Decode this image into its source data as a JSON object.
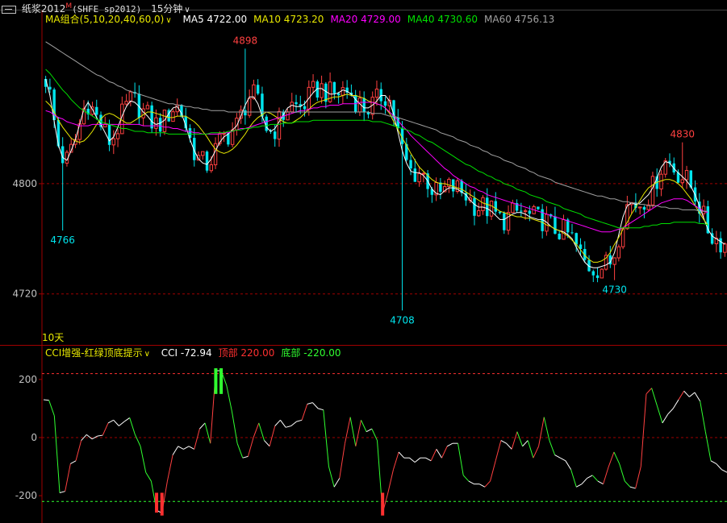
{
  "title_bar": {
    "symbol_name": "纸浆2012",
    "main_flag": "M",
    "code": "(SHFE sp2012)",
    "period": "15分钟",
    "period_arrow": "∨"
  },
  "ma_legend": {
    "name": "MA组合(5,10,20,40,60,0)",
    "arrow": "∨",
    "items": [
      {
        "label": "MA5 4722.00",
        "color": "#ffffff"
      },
      {
        "label": "MA10 4723.20",
        "color": "#e8e800"
      },
      {
        "label": "MA20 4729.00",
        "color": "#ff00ff"
      },
      {
        "label": "MA40 4730.60",
        "color": "#00e000"
      },
      {
        "label": "MA60 4756.13",
        "color": "#a0a0a0"
      }
    ]
  },
  "cci_legend": {
    "name": "CCI增强-红绿顶底提示",
    "arrow": "∨",
    "items": [
      {
        "label": "CCI -72.94",
        "color": "#ffffff"
      },
      {
        "label": "顶部 220.00",
        "color": "#ff3030"
      },
      {
        "label": "底部 -220.00",
        "color": "#30ff30"
      }
    ]
  },
  "range_label": "10天",
  "colors": {
    "up": "#ff4040",
    "down": "#00e5ee",
    "frame": "#a00000",
    "grid": "#a00000",
    "cci_top": "#ff3030",
    "cci_bottom": "#30ff30"
  },
  "chart_data": [
    {
      "type": "candlestick",
      "y_ticks": [
        4800,
        4720
      ],
      "ylim": [
        4683,
        4914
      ],
      "annotations": [
        {
          "text": "4898",
          "value": 4898,
          "index": 47,
          "kind": "high"
        },
        {
          "text": "4830",
          "value": 4830,
          "index": 150,
          "kind": "high"
        },
        {
          "text": "4766",
          "value": 4766,
          "index": 4,
          "kind": "low"
        },
        {
          "text": "4708",
          "value": 4708,
          "index": 84,
          "kind": "low"
        },
        {
          "text": "4730",
          "value": 4730,
          "index": 134,
          "kind": "low"
        }
      ],
      "series": [
        {
          "name": "MA5",
          "color": "#ffffff",
          "values": [
            4876,
            4864,
            4845,
            4828,
            4819,
            4817,
            4824,
            4832,
            4843,
            4854,
            4859,
            4854,
            4848,
            4843,
            4837,
            4831,
            4834,
            4841,
            4849,
            4856,
            4860,
            4859,
            4856,
            4852,
            4849,
            4845,
            4843,
            4844,
            4846,
            4851,
            4855,
            4856,
            4851,
            4842,
            4832,
            4824,
            4818,
            4815,
            4814,
            4818,
            4824,
            4830,
            4834,
            4836,
            4839,
            4842,
            4849,
            4857,
            4863,
            4863,
            4858,
            4849,
            4841,
            4838,
            4840,
            4845,
            4850,
            4855,
            4857,
            4856,
            4856,
            4858,
            4862,
            4866,
            4869,
            4869,
            4867,
            4865,
            4865,
            4866,
            4868,
            4867,
            4865,
            4861,
            4858,
            4855,
            4855,
            4857,
            4860,
            4864,
            4864,
            4860,
            4850,
            4837,
            4824,
            4815,
            4809,
            4808,
            4808,
            4806,
            4802,
            4796,
            4793,
            4792,
            4795,
            4797,
            4797,
            4796,
            4794,
            4792,
            4788,
            4785,
            4783,
            4783,
            4782,
            4780,
            4777,
            4774,
            4774,
            4776,
            4778,
            4779,
            4779,
            4778,
            4776,
            4775,
            4774,
            4774,
            4772,
            4769,
            4767,
            4766,
            4765,
            4763,
            4760,
            4754,
            4748,
            4743,
            4740,
            4739,
            4739,
            4740,
            4741,
            4743,
            4750,
            4763,
            4776,
            4784,
            4786,
            4785,
            4786,
            4789,
            4792,
            4797,
            4804,
            4812,
            4816,
            4815,
            4811,
            4808,
            4805,
            4802,
            4798,
            4792,
            4784,
            4775,
            4767,
            4762,
            4760,
            4758,
            4756
          ]
        },
        {
          "name": "MA10",
          "color": "#e8e800",
          "values": [
            4860,
            4857,
            4852,
            4846,
            4841,
            4837,
            4833,
            4831,
            4830,
            4831,
            4834,
            4838,
            4843,
            4847,
            4850,
            4851,
            4850,
            4848,
            4846,
            4844,
            4844,
            4846,
            4848,
            4850,
            4852,
            4852,
            4851,
            4850,
            4849,
            4848,
            4848,
            4849,
            4849,
            4849,
            4847,
            4845,
            4842,
            4838,
            4834,
            4829,
            4825,
            4823,
            4822,
            4823,
            4825,
            4828,
            4832,
            4836,
            4841,
            4845,
            4848,
            4850,
            4852,
            4851,
            4849,
            4847,
            4845,
            4844,
            4844,
            4846,
            4848,
            4851,
            4854,
            4857,
            4859,
            4860,
            4861,
            4862,
            4863,
            4863,
            4864,
            4865,
            4864,
            4864,
            4863,
            4862,
            4860,
            4859,
            4858,
            4857,
            4855,
            4851,
            4845,
            4839,
            4833,
            4828,
            4822,
            4817,
            4812,
            4809,
            4806,
            4803,
            4801,
            4800,
            4800,
            4799,
            4798,
            4797,
            4796,
            4794,
            4792,
            4790,
            4788,
            4786,
            4785,
            4784,
            4782,
            4780,
            4779,
            4778,
            4777,
            4776,
            4776,
            4775,
            4775,
            4774,
            4773,
            4772,
            4770,
            4769,
            4767,
            4766,
            4764,
            4762,
            4759,
            4756,
            4752,
            4748,
            4745,
            4743,
            4743,
            4744,
            4746,
            4750,
            4756,
            4761,
            4767,
            4772,
            4778,
            4783,
            4788,
            4793,
            4797,
            4799,
            4801,
            4802,
            4803,
            4803,
            4802,
            4800,
            4797,
            4793,
            4789,
            4784,
            4779,
            4774,
            4770
          ]
        },
        {
          "name": "MA20",
          "color": "#ff00ff",
          "values": [
            4853,
            4852,
            4850,
            4848,
            4847,
            4845,
            4844,
            4843,
            4842,
            4842,
            4842,
            4843,
            4843,
            4843,
            4843,
            4843,
            4843,
            4843,
            4843,
            4843,
            4843,
            4843,
            4843,
            4842,
            4842,
            4842,
            4842,
            4842,
            4841,
            4841,
            4840,
            4840,
            4839,
            4838,
            4838,
            4837,
            4837,
            4836,
            4836,
            4836,
            4836,
            4836,
            4837,
            4837,
            4838,
            4839,
            4840,
            4840,
            4841,
            4842,
            4843,
            4844,
            4845,
            4846,
            4847,
            4848,
            4849,
            4850,
            4851,
            4852,
            4853,
            4853,
            4854,
            4855,
            4855,
            4856,
            4856,
            4857,
            4857,
            4857,
            4858,
            4858,
            4858,
            4858,
            4859,
            4859,
            4859,
            4859,
            4858,
            4857,
            4855,
            4852,
            4849,
            4846,
            4842,
            4839,
            4835,
            4832,
            4829,
            4826,
            4823,
            4820,
            4817,
            4814,
            4811,
            4809,
            4806,
            4804,
            4802,
            4800,
            4798,
            4797,
            4795,
            4794,
            4792,
            4791,
            4790,
            4789,
            4788,
            4787,
            4786,
            4785,
            4784,
            4783,
            4782,
            4781,
            4780,
            4779,
            4778,
            4777,
            4776,
            4775,
            4774,
            4773,
            4772,
            4771,
            4770,
            4769,
            4768,
            4767,
            4766,
            4765,
            4765,
            4765,
            4766,
            4767,
            4768,
            4770,
            4772,
            4774,
            4776,
            4778,
            4780,
            4782,
            4784,
            4786,
            4787,
            4788,
            4789,
            4789,
            4789,
            4788,
            4786,
            4784,
            4782,
            4780,
            4779
          ]
        },
        {
          "name": "MA40",
          "color": "#00e000",
          "values": [
            4883,
            4880,
            4876,
            4872,
            4868,
            4865,
            4861,
            4858,
            4855,
            4853,
            4851,
            4849,
            4847,
            4845,
            4844,
            4843,
            4842,
            4841,
            4840,
            4840,
            4839,
            4838,
            4838,
            4838,
            4837,
            4837,
            4837,
            4837,
            4837,
            4836,
            4836,
            4836,
            4836,
            4836,
            4836,
            4836,
            4836,
            4836,
            4836,
            4837,
            4837,
            4837,
            4837,
            4838,
            4838,
            4839,
            4839,
            4840,
            4840,
            4841,
            4841,
            4842,
            4842,
            4843,
            4843,
            4843,
            4844,
            4844,
            4844,
            4845,
            4845,
            4845,
            4845,
            4846,
            4846,
            4846,
            4846,
            4846,
            4846,
            4846,
            4846,
            4846,
            4846,
            4846,
            4846,
            4846,
            4846,
            4845,
            4845,
            4845,
            4844,
            4843,
            4842,
            4841,
            4840,
            4839,
            4838,
            4836,
            4835,
            4833,
            4831,
            4830,
            4828,
            4826,
            4824,
            4822,
            4820,
            4818,
            4816,
            4814,
            4813,
            4811,
            4809,
            4808,
            4806,
            4805,
            4803,
            4802,
            4800,
            4799,
            4798,
            4796,
            4795,
            4794,
            4792,
            4791,
            4790,
            4789,
            4787,
            4786,
            4785,
            4784,
            4782,
            4781,
            4780,
            4779,
            4778,
            4776,
            4775,
            4774,
            4773,
            4772,
            4771,
            4770,
            4769,
            4768,
            4768,
            4768,
            4768,
            4768,
            4768,
            4769,
            4769,
            4770,
            4770,
            4771,
            4771,
            4771,
            4772,
            4772,
            4772,
            4772,
            4772,
            4772,
            4771,
            4771,
            4770
          ]
        },
        {
          "name": "MA60",
          "color": "#a0a0a0",
          "values": [
            4903,
            4901,
            4899,
            4897,
            4895,
            4893,
            4891,
            4889,
            4887,
            4885,
            4883,
            4881,
            4879,
            4878,
            4876,
            4874,
            4873,
            4871,
            4870,
            4868,
            4867,
            4866,
            4865,
            4864,
            4863,
            4862,
            4861,
            4860,
            4859,
            4858,
            4858,
            4857,
            4857,
            4856,
            4856,
            4855,
            4855,
            4854,
            4854,
            4853,
            4853,
            4853,
            4853,
            4852,
            4852,
            4852,
            4852,
            4852,
            4852,
            4852,
            4852,
            4852,
            4852,
            4852,
            4852,
            4852,
            4852,
            4852,
            4852,
            4852,
            4852,
            4852,
            4852,
            4852,
            4852,
            4852,
            4852,
            4852,
            4852,
            4852,
            4852,
            4852,
            4852,
            4852,
            4852,
            4852,
            4852,
            4851,
            4851,
            4851,
            4850,
            4849,
            4849,
            4848,
            4847,
            4846,
            4845,
            4844,
            4843,
            4842,
            4841,
            4840,
            4839,
            4837,
            4836,
            4835,
            4834,
            4832,
            4831,
            4830,
            4828,
            4827,
            4826,
            4824,
            4823,
            4821,
            4820,
            4819,
            4817,
            4816,
            4815,
            4813,
            4812,
            4811,
            4809,
            4808,
            4806,
            4805,
            4804,
            4803,
            4801,
            4800,
            4799,
            4798,
            4797,
            4796,
            4795,
            4794,
            4793,
            4792,
            4791,
            4791,
            4790,
            4789,
            4789,
            4788,
            4787,
            4787,
            4786,
            4786,
            4785,
            4785,
            4784,
            4784,
            4784,
            4783,
            4783,
            4782,
            4782,
            4782,
            4781,
            4781,
            4781,
            4781,
            4780,
            4780,
            4780
          ]
        }
      ]
    },
    {
      "type": "line",
      "name": "CCI",
      "y_ticks": [
        200,
        0,
        -200
      ],
      "ylim": [
        -294,
        266
      ],
      "top_line": 220,
      "bottom_line": -220,
      "series": [
        {
          "name": "CCI",
          "values": [
            130,
            128,
            75,
            -190,
            -185,
            -90,
            -80,
            -10,
            10,
            -5,
            5,
            8,
            50,
            60,
            40,
            55,
            68,
            10,
            -30,
            -120,
            -150,
            -250,
            -260,
            -150,
            -60,
            -30,
            -40,
            -30,
            -40,
            30,
            50,
            -20,
            230,
            230,
            180,
            90,
            -20,
            -70,
            -65,
            0,
            50,
            -10,
            -30,
            40,
            60,
            35,
            40,
            55,
            60,
            115,
            120,
            100,
            95,
            -100,
            -170,
            -140,
            -20,
            70,
            -30,
            60,
            20,
            30,
            -10,
            -260,
            -190,
            -110,
            -50,
            -70,
            -70,
            -85,
            -70,
            -70,
            -80,
            -40,
            -70,
            -30,
            -20,
            -20,
            -130,
            -150,
            -160,
            -160,
            -170,
            -150,
            -80,
            -10,
            -20,
            -40,
            20,
            -30,
            -10,
            -70,
            -30,
            70,
            -10,
            -60,
            -70,
            -80,
            -110,
            -170,
            -160,
            -140,
            -130,
            -150,
            -160,
            -100,
            -50,
            -90,
            -150,
            -170,
            -175,
            -100,
            150,
            170,
            110,
            50,
            80,
            100,
            130,
            160,
            140,
            155,
            125,
            20,
            -80,
            -90,
            -110,
            -120
          ]
        }
      ]
    }
  ]
}
